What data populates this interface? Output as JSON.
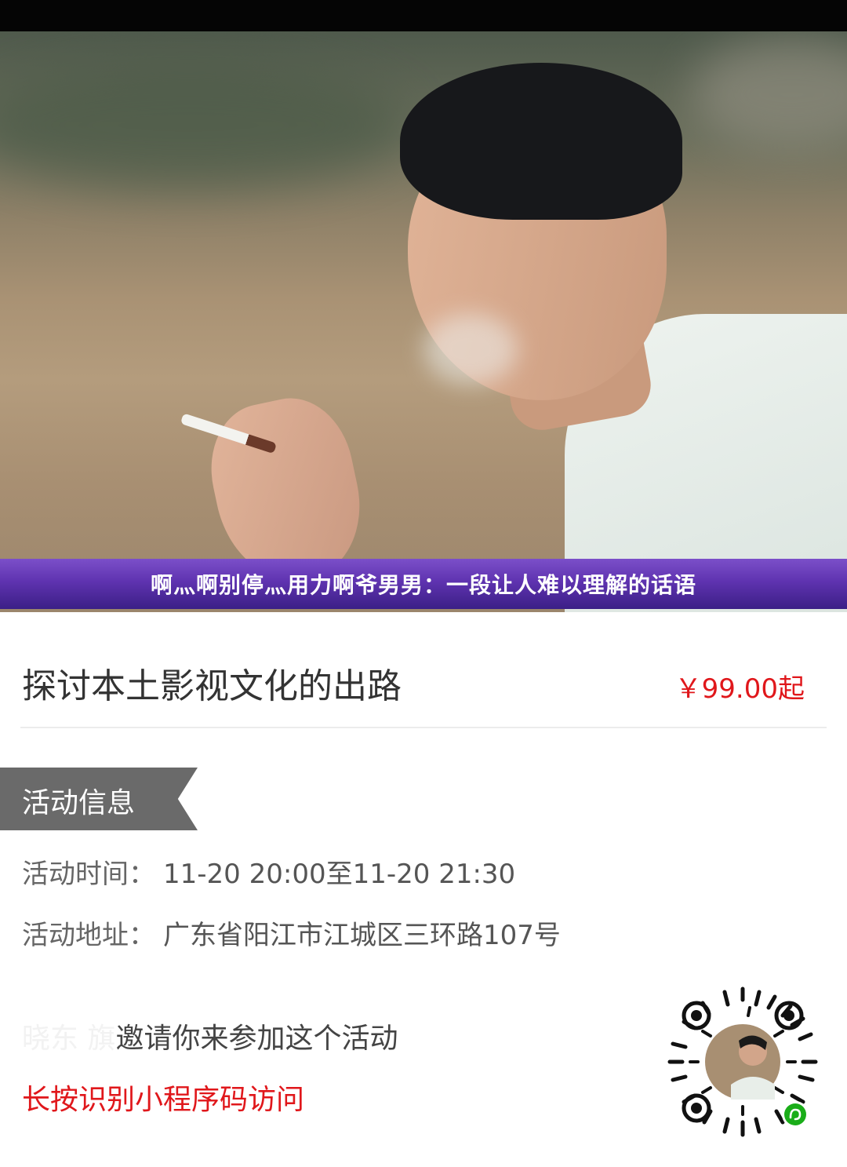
{
  "banner": {
    "title": "啊灬啊别停灬用力啊爷男男：一段让人难以理解的话语"
  },
  "event": {
    "title": "探讨本土影视文化的出路",
    "price": "￥99.00起"
  },
  "section": {
    "label": "活动信息"
  },
  "details": {
    "time_key": "活动时间：",
    "time_value": "11-20 20:00至11-20 21:30",
    "addr_key": "活动地址：",
    "addr_value": "广东省阳江市江城区三环路107号"
  },
  "invite": {
    "who": "晓东 旗",
    "text": "邀请你来参加这个活动"
  },
  "hint": {
    "text": "长按识别小程序码访问"
  },
  "icons": {
    "qr": "mini-program-code-icon",
    "wechat": "wechat-mini-program-icon"
  },
  "colors": {
    "price": "#e0171b",
    "tag": "#6a6a6a",
    "banner": "#5f33b0"
  }
}
